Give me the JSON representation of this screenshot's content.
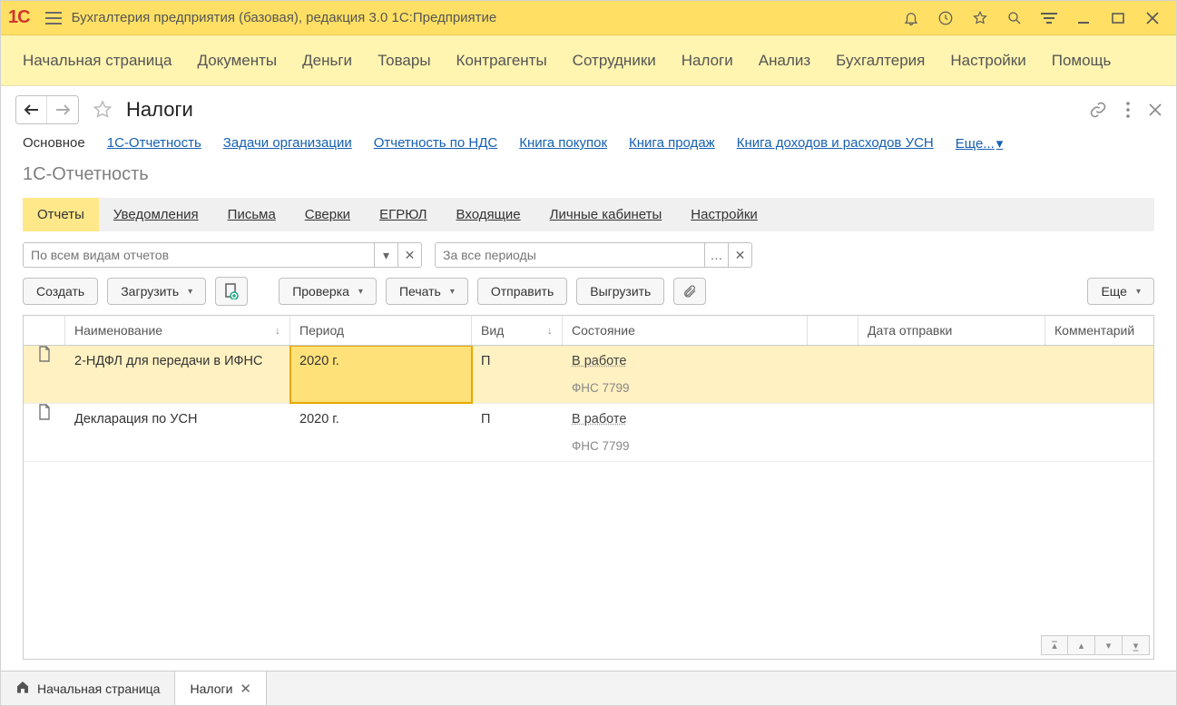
{
  "app": {
    "title": "Бухгалтерия предприятия (базовая), редакция 3.0 1С:Предприятие"
  },
  "menu": {
    "items": [
      "Начальная страница",
      "Документы",
      "Деньги",
      "Товары",
      "Контрагенты",
      "Сотрудники",
      "Налоги",
      "Анализ",
      "Бухгалтерия",
      "Настройки",
      "Помощь"
    ]
  },
  "page": {
    "title": "Налоги",
    "subnav": {
      "current": "Основное",
      "links": [
        "1С-Отчетность",
        "Задачи организации",
        "Отчетность по НДС",
        "Книга покупок",
        "Книга продаж",
        "Книга доходов и расходов УСН"
      ],
      "more": "Еще..."
    },
    "section_title": "1С-Отчетность",
    "tabs": [
      "Отчеты",
      "Уведомления",
      "Письма",
      "Сверки",
      "ЕГРЮЛ",
      "Входящие",
      "Личные кабинеты",
      "Настройки"
    ],
    "active_tab": "Отчеты",
    "filters": {
      "report_type_placeholder": "По всем видам отчетов",
      "period_placeholder": "За все периоды"
    },
    "toolbar": {
      "create": "Создать",
      "load": "Загрузить",
      "check": "Проверка",
      "print": "Печать",
      "send": "Отправить",
      "export": "Выгрузить",
      "more": "Еще"
    },
    "table": {
      "columns": {
        "name": "Наименование",
        "period": "Период",
        "kind": "Вид",
        "state": "Состояние",
        "date": "Дата отправки",
        "comment": "Комментарий"
      },
      "rows": [
        {
          "name": "2-НДФЛ для передачи в ИФНС",
          "period": "2020 г.",
          "kind": "П",
          "state": "В работе",
          "agency": "ФНС 7799",
          "date": "",
          "comment": "",
          "selected": true
        },
        {
          "name": "Декларация по УСН",
          "period": "2020 г.",
          "kind": "П",
          "state": "В работе",
          "agency": "ФНС 7799",
          "date": "",
          "comment": "",
          "selected": false
        }
      ]
    }
  },
  "bottom_tabs": {
    "home": "Начальная страница",
    "active": "Налоги"
  }
}
